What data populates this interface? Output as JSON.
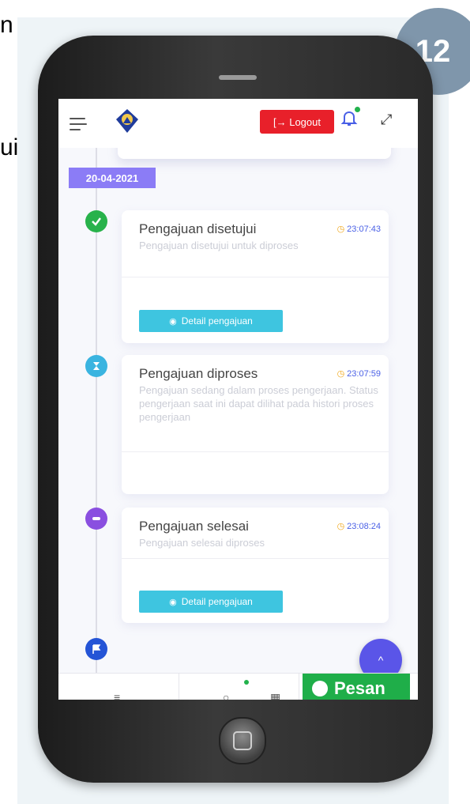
{
  "side_text": {
    "fragment_1": "n",
    "fragment_2": "ui"
  },
  "page_number": "12",
  "app": {
    "topbar": {
      "logout_label": "[→ Logout",
      "icons": [
        "menu-icon",
        "emblem-logo",
        "bell-icon",
        "expand-icon"
      ]
    },
    "date_badge": "20-04-2021",
    "timeline": [
      {
        "title": "Pengajuan disetujui",
        "time": "23:07:43",
        "description": "Pengajuan disetujui untuk diproses",
        "button": "Detail pengajuan",
        "marker_color": "#28b24b",
        "marker_icon": "check-icon"
      },
      {
        "title": "Pengajuan diproses",
        "time": "23:07:59",
        "description": "Pengajuan sedang dalam proses pengerjaan. Status pengerjaan saat ini dapat dilihat pada histori proses pengerjaan",
        "button": "",
        "marker_color": "#3ab4e0",
        "marker_icon": "hourglass-icon"
      },
      {
        "title": "Pengajuan selesai",
        "time": "23:08:24",
        "description": "Pengajuan selesai diproses",
        "button": "Detail pengajuan",
        "marker_color": "#8a4fe0",
        "marker_icon": "minus-icon"
      }
    ],
    "final_marker": {
      "color": "#2454d6",
      "icon": "flag-icon"
    },
    "scroll_top_icon": "^",
    "bottom_nav": {
      "icons": [
        "list-icon",
        "search-icon",
        "grid-icon"
      ],
      "chat_button": "Pesan"
    }
  },
  "colors": {
    "logout": "#e8202a",
    "date_badge": "#8b7cf6",
    "detail_button": "#3ec5e0",
    "chat_button": "#1fae49",
    "scroll_button": "#5a55e8",
    "time": "#4a60e6"
  }
}
